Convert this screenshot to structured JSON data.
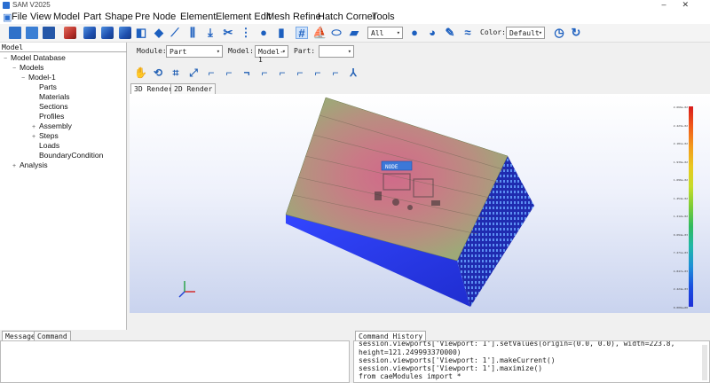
{
  "window": {
    "title": "SAM V2025"
  },
  "menu": [
    {
      "label": "File"
    },
    {
      "label": "View"
    },
    {
      "label": "Model"
    },
    {
      "label": "Part"
    },
    {
      "label": "Shape"
    },
    {
      "label": "Pre"
    },
    {
      "label": "Node"
    },
    {
      "label": "Element"
    },
    {
      "label": "Element Edit"
    },
    {
      "label": "Mesh Refine"
    },
    {
      "label": "Hatch Corner"
    },
    {
      "label": "Tools"
    }
  ],
  "toolbar": {
    "filter_value": "All",
    "color_label": "Color:",
    "color_value": "Default"
  },
  "modelbar": {
    "module_label": "Module:",
    "module_value": "Part",
    "model_label": "Model:",
    "model_value": "Model-1",
    "part_label": "Part:",
    "part_value": ""
  },
  "tree": {
    "header": "Model",
    "items": [
      {
        "label": "Model Database",
        "expander": "−"
      },
      {
        "label": "Models",
        "expander": "−"
      },
      {
        "label": "Model-1",
        "expander": "−"
      },
      {
        "label": "Parts",
        "expander": ""
      },
      {
        "label": "Materials",
        "expander": ""
      },
      {
        "label": "Sections",
        "expander": ""
      },
      {
        "label": "Profiles",
        "expander": ""
      },
      {
        "label": "Assembly",
        "expander": "+"
      },
      {
        "label": "Steps",
        "expander": "+"
      },
      {
        "label": "Loads",
        "expander": ""
      },
      {
        "label": "BoundaryCondition",
        "expander": ""
      },
      {
        "label": "Analysis",
        "expander": "+"
      }
    ]
  },
  "view_tabs": [
    {
      "label": "3D Render"
    },
    {
      "label": "2D Render"
    }
  ],
  "viewport": {
    "probe_label": "NODE",
    "legend_colors": [
      "#d81b1b",
      "#f05a1a",
      "#f39a1c",
      "#e9c81f",
      "#c6dc2a",
      "#7ccc37",
      "#2fba5f",
      "#1fb7a8",
      "#1d8fd8",
      "#1a4fe0",
      "#1d2fd8"
    ],
    "legend_values": [
      "2.666e-02",
      "2.423e-02",
      "2.181e-02",
      "1.939e-02",
      "1.696e-02",
      "1.454e-02",
      "1.212e-02",
      "9.694e-03",
      "7.271e-03",
      "4.847e-03",
      "2.424e-03",
      "0.000e+00"
    ]
  },
  "bottom": {
    "message_tab": "Message",
    "command_tab": "Command",
    "history_title": "Command History",
    "history_lines": [
      "session.viewports['Viewport: 1'].setValues(origin=(0.0, 0.0), width=223.8,",
      "height=121.249993370000)",
      "session.viewports['Viewport: 1'].makeCurrent()",
      "session.viewports['Viewport: 1'].maximize()",
      "from caeModules import *"
    ]
  }
}
